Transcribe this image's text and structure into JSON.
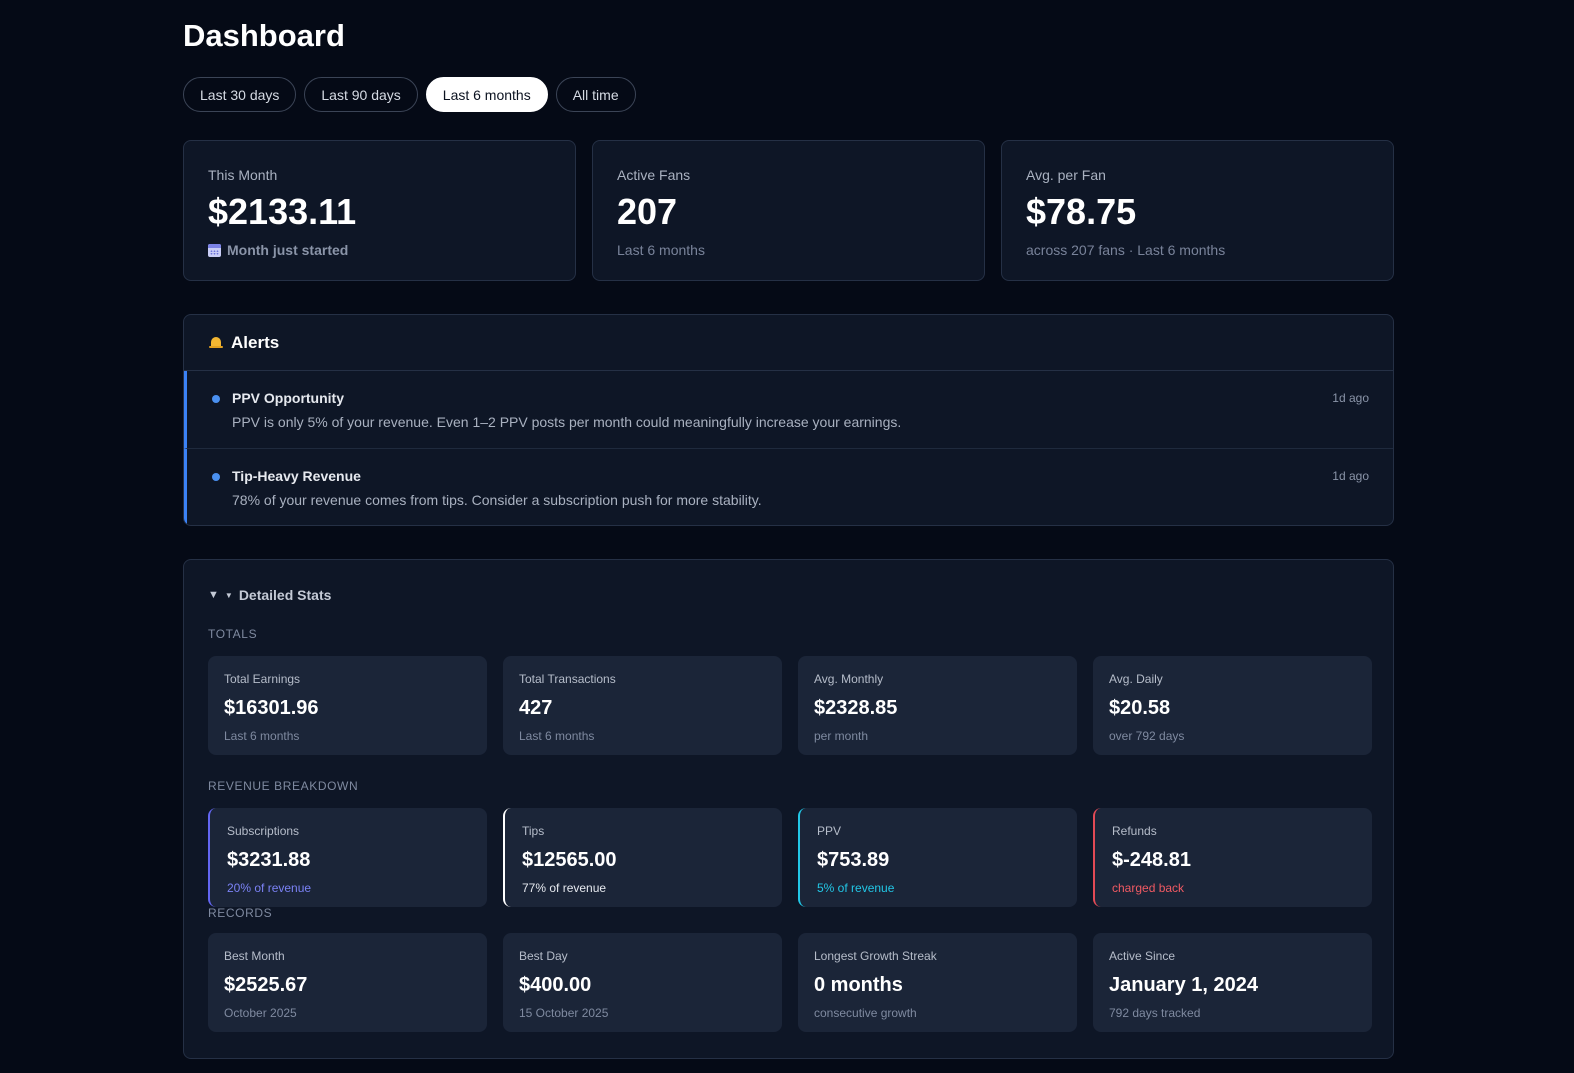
{
  "page": {
    "title": "Dashboard"
  },
  "range_tabs": [
    {
      "label": "Last 30 days",
      "active": false
    },
    {
      "label": "Last 90 days",
      "active": false
    },
    {
      "label": "Last 6 months",
      "active": true
    },
    {
      "label": "All time",
      "active": false
    }
  ],
  "summary": [
    {
      "label": "This Month",
      "value": "$2133.11",
      "sub": "Month just started",
      "icon": "calendar-icon"
    },
    {
      "label": "Active Fans",
      "value": "207",
      "sub": "Last 6 months"
    },
    {
      "label": "Avg. per Fan",
      "value": "$78.75",
      "sub": "across 207 fans · Last 6 months"
    }
  ],
  "alerts": {
    "title": "Alerts",
    "icon": "bell-icon",
    "items": [
      {
        "title": "PPV Opportunity",
        "text": "PPV is only 5% of your revenue. Even 1–2 PPV posts per month could meaningfully increase your earnings.",
        "time": "1d ago"
      },
      {
        "title": "Tip-Heavy Revenue",
        "text": "78% of your revenue comes from tips. Consider a subscription push for more stability.",
        "time": "1d ago"
      }
    ]
  },
  "details": {
    "toggle_label": "Detailed Stats",
    "totals_label": "TOTALS",
    "totals": [
      {
        "label": "Total Earnings",
        "value": "$16301.96",
        "sub": "Last 6 months"
      },
      {
        "label": "Total Transactions",
        "value": "427",
        "sub": "Last 6 months"
      },
      {
        "label": "Avg. Monthly",
        "value": "$2328.85",
        "sub": "per month"
      },
      {
        "label": "Avg. Daily",
        "value": "$20.58",
        "sub": "over 792 days"
      }
    ],
    "revenue_label": "REVENUE BREAKDOWN",
    "revenue": [
      {
        "label": "Subscriptions",
        "value": "$3231.88",
        "sub": "20% of revenue",
        "accent": "#6366f1"
      },
      {
        "label": "Tips",
        "value": "$12565.00",
        "sub": "77% of revenue",
        "accent": "#ffffff"
      },
      {
        "label": "PPV",
        "value": "$753.89",
        "sub": "5% of revenue",
        "accent": "#22c7e6"
      },
      {
        "label": "Refunds",
        "value": "$-248.81",
        "sub": "charged back",
        "accent": "#e24a55"
      }
    ],
    "records_label": "RECORDS",
    "records": [
      {
        "label": "Best Month",
        "value": "$2525.67",
        "sub": "October 2025"
      },
      {
        "label": "Best Day",
        "value": "$400.00",
        "sub": "15 October 2025"
      },
      {
        "label": "Longest Growth Streak",
        "value": "0 months",
        "sub": "consecutive growth"
      },
      {
        "label": "Active Since",
        "value": "January 1, 2024",
        "sub": "792 days tracked"
      }
    ]
  }
}
